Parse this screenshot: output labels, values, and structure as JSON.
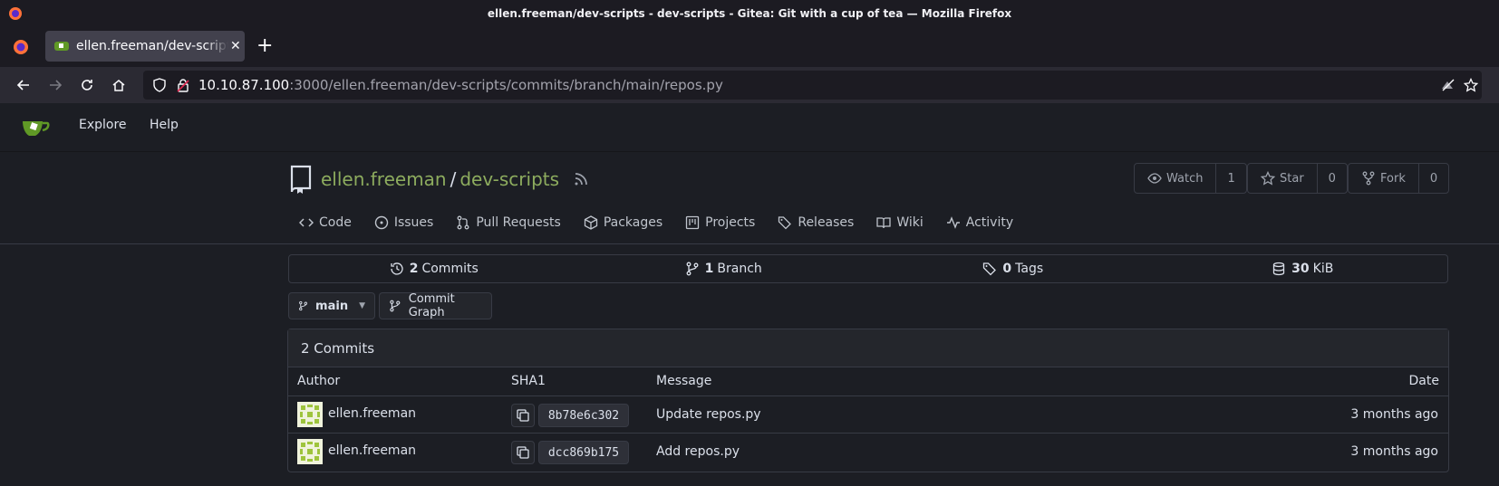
{
  "window": {
    "title": "ellen.freeman/dev-scripts - dev-scripts - Gitea: Git with a cup of tea — Mozilla Firefox"
  },
  "browser": {
    "tab_label": "ellen.freeman/dev-scripts",
    "url_host": "10.10.87.100",
    "url_rest": ":3000/ellen.freeman/dev-scripts/commits/branch/main/repos.py"
  },
  "nav": {
    "explore": "Explore",
    "help": "Help"
  },
  "repo": {
    "owner": "ellen.freeman",
    "separator": "/",
    "name": "dev-scripts",
    "watch_label": "Watch",
    "watch_count": "1",
    "star_label": "Star",
    "star_count": "0",
    "fork_label": "Fork",
    "fork_count": "0"
  },
  "tabs": {
    "code": "Code",
    "issues": "Issues",
    "pulls": "Pull Requests",
    "packages": "Packages",
    "projects": "Projects",
    "releases": "Releases",
    "wiki": "Wiki",
    "activity": "Activity"
  },
  "stats": {
    "commits_num": "2",
    "commits_label": "Commits",
    "branch_num": "1",
    "branch_label": "Branch",
    "tags_num": "0",
    "tags_label": "Tags",
    "size_num": "30",
    "size_label": "KiB"
  },
  "branch": {
    "current": "main",
    "graph_label": "Commit Graph"
  },
  "commits": {
    "header": "2 Commits",
    "col_author": "Author",
    "col_sha": "SHA1",
    "col_message": "Message",
    "col_date": "Date",
    "rows": [
      {
        "author": "ellen.freeman",
        "sha": "8b78e6c302",
        "message": "Update repos.py",
        "date": "3 months ago"
      },
      {
        "author": "ellen.freeman",
        "sha": "dcc869b175",
        "message": "Add repos.py",
        "date": "3 months ago"
      }
    ]
  },
  "colors": {
    "accent": "#8dac5e",
    "bg": "#1c1e24",
    "border": "#383b45"
  }
}
